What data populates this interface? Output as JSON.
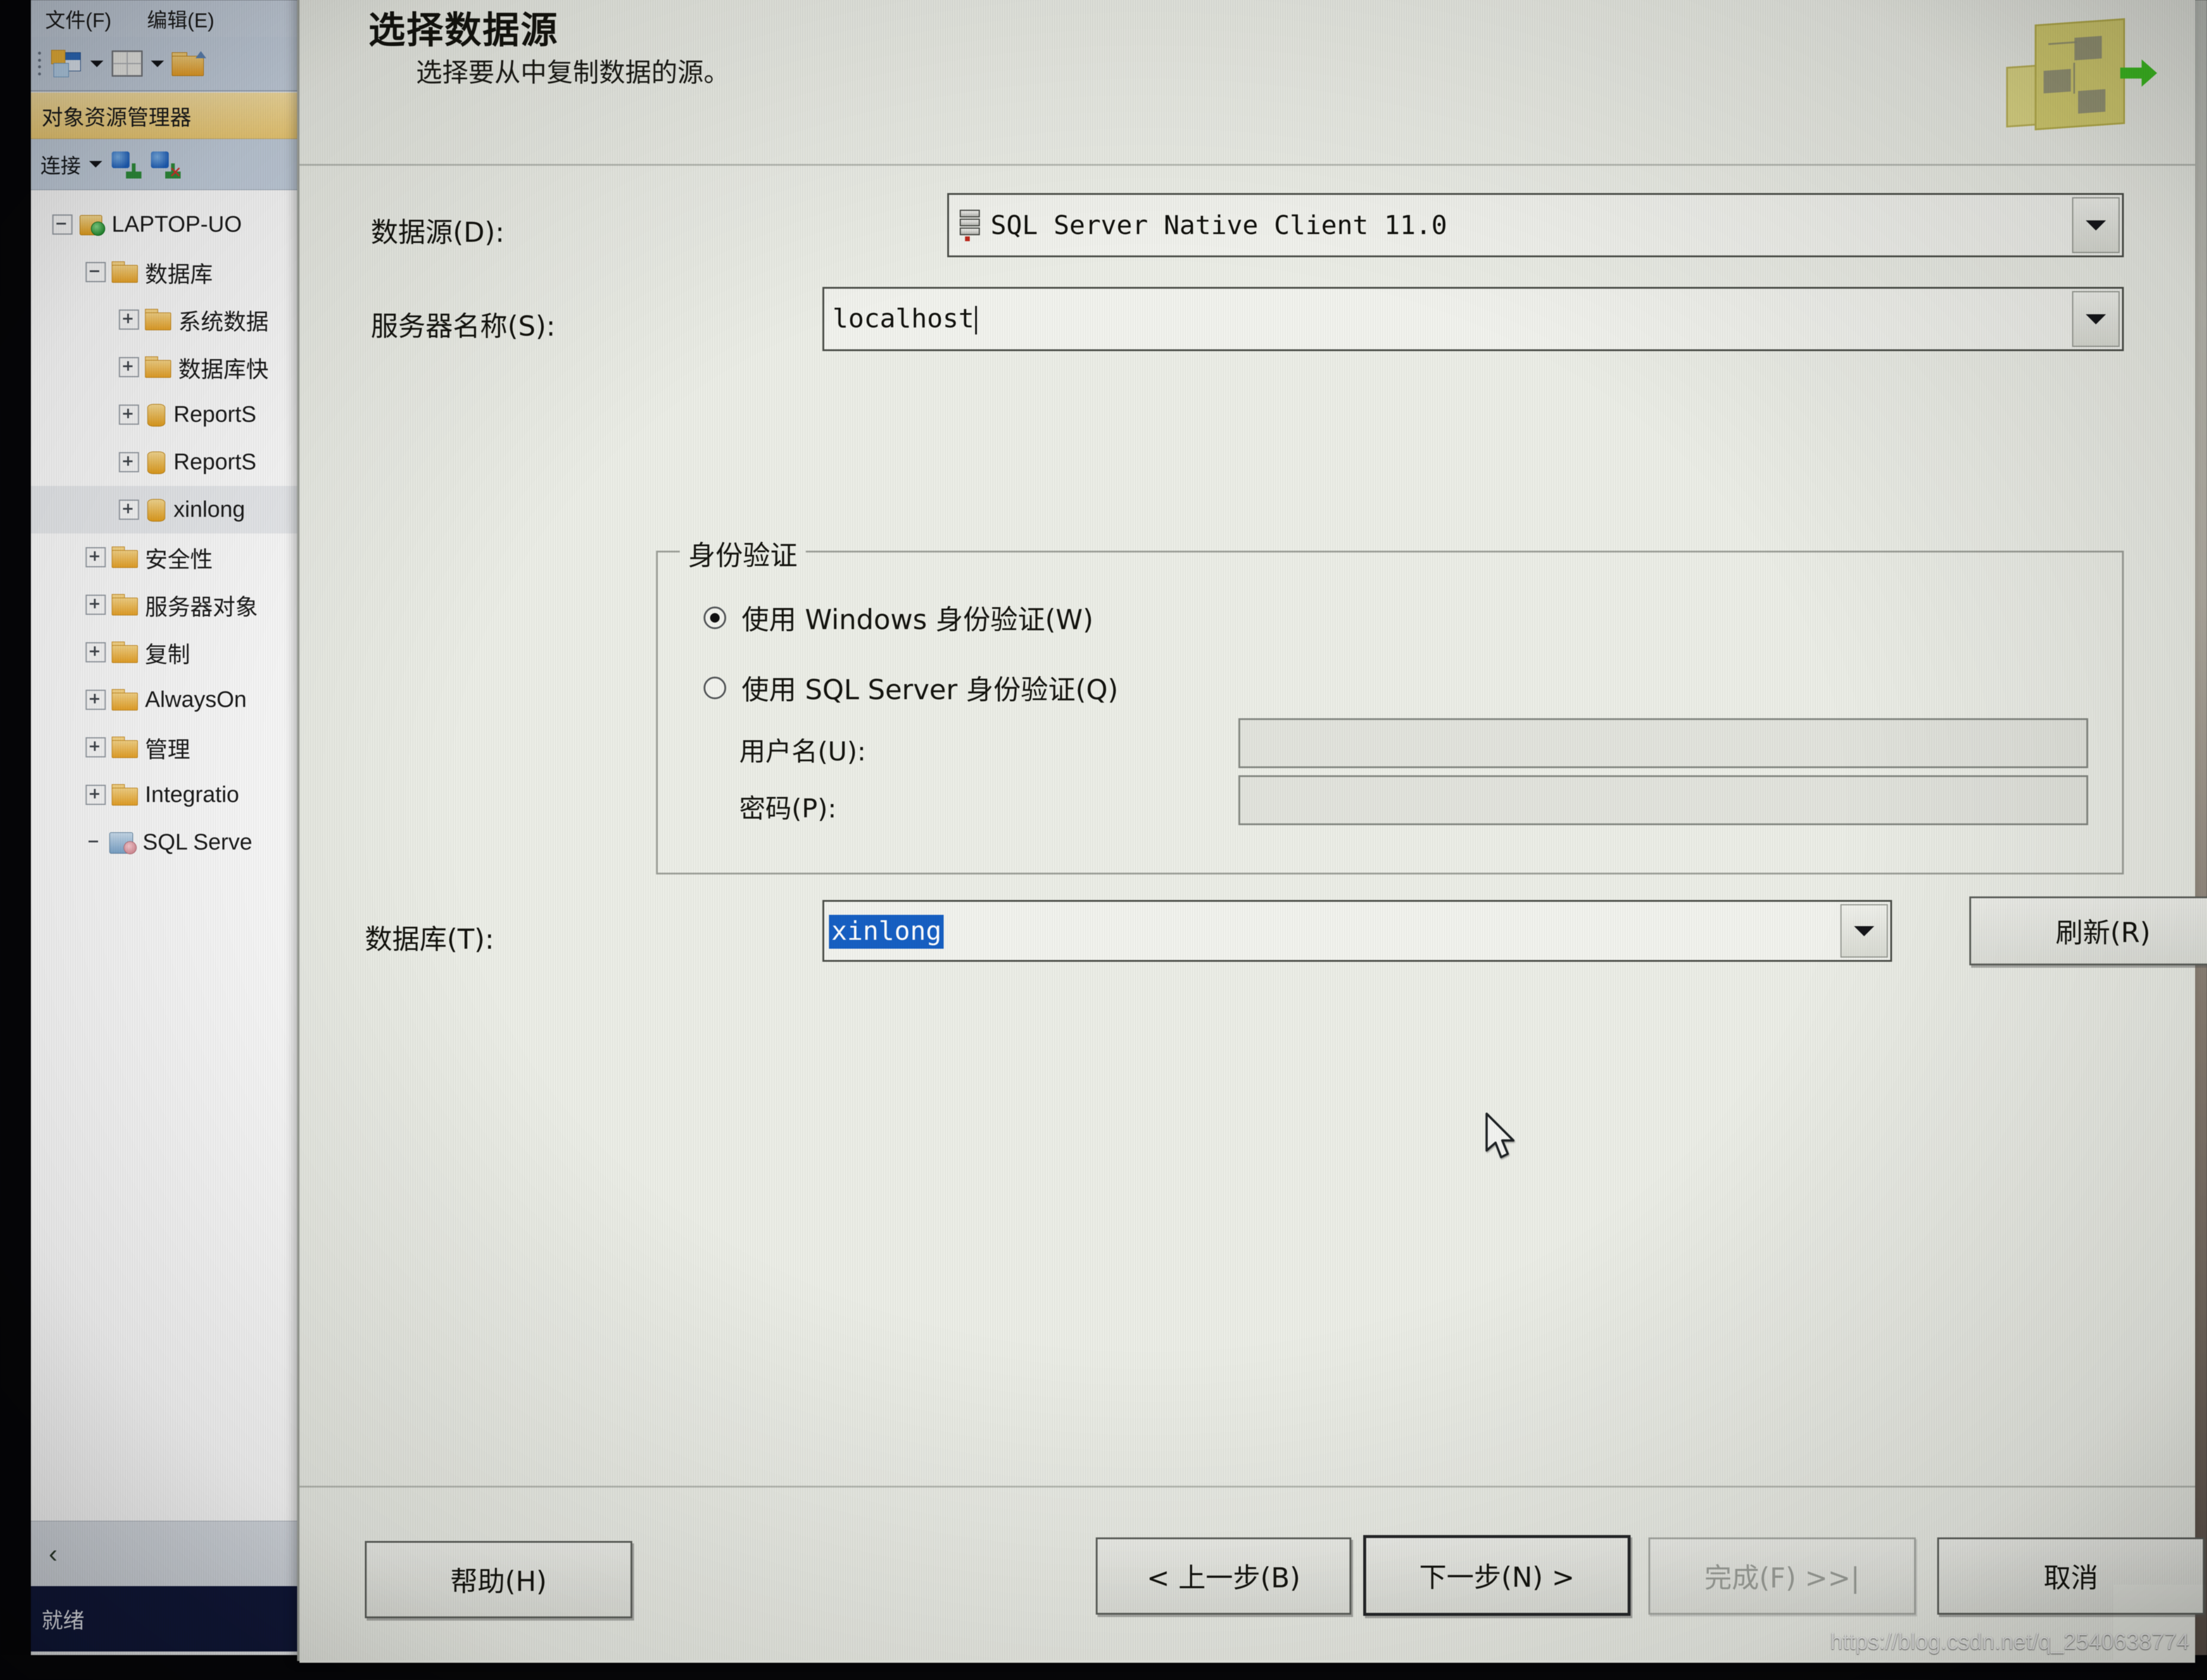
{
  "app": {
    "menu": [
      {
        "label": "文件(F)"
      },
      {
        "label": "编辑(E)"
      }
    ],
    "toolbar_icons": [
      "new-query-icon",
      "dropdown-caret-icon",
      "new-table-icon",
      "dropdown-caret-icon",
      "open-file-icon"
    ],
    "object_explorer": {
      "title": "对象资源管理器",
      "connect_label": "连接",
      "tree": [
        {
          "level": 0,
          "expander": "minus",
          "icon": "server-icon",
          "label": "LAPTOP-UO"
        },
        {
          "level": 1,
          "expander": "minus",
          "icon": "folder-icon",
          "label": "数据库"
        },
        {
          "level": 2,
          "expander": "plus",
          "icon": "folder-icon",
          "label": "系统数据"
        },
        {
          "level": 2,
          "expander": "plus",
          "icon": "folder-icon",
          "label": "数据库快"
        },
        {
          "level": 2,
          "expander": "plus",
          "icon": "database-icon",
          "label": "ReportS"
        },
        {
          "level": 2,
          "expander": "plus",
          "icon": "database-icon",
          "label": "ReportS"
        },
        {
          "level": 2,
          "expander": "plus",
          "icon": "database-icon",
          "label": "xinlong",
          "selected": true
        },
        {
          "level": 1,
          "expander": "plus",
          "icon": "folder-icon",
          "label": "安全性"
        },
        {
          "level": 1,
          "expander": "plus",
          "icon": "folder-icon",
          "label": "服务器对象"
        },
        {
          "level": 1,
          "expander": "plus",
          "icon": "folder-icon",
          "label": "复制"
        },
        {
          "level": 1,
          "expander": "plus",
          "icon": "folder-icon",
          "label": "AlwaysOn"
        },
        {
          "level": 1,
          "expander": "plus",
          "icon": "folder-icon",
          "label": "管理"
        },
        {
          "level": 1,
          "expander": "plus",
          "icon": "folder-icon",
          "label": "Integratio"
        },
        {
          "level": 1,
          "expander": "none",
          "icon": "sql-agent-icon",
          "label": "SQL Serve"
        }
      ]
    },
    "status_bar": {
      "text": "就绪"
    },
    "collapse_chevron": "‹"
  },
  "dialog": {
    "title": "选择数据源",
    "subtitle": "选择要从中复制数据的源。",
    "wizard_icon": "data-flow-wizard-icon",
    "fields": {
      "data_source": {
        "label": "数据源(D):",
        "value": "SQL Server Native Client 11.0",
        "icon": "data-provider-icon"
      },
      "server_name": {
        "label": "服务器名称(S):",
        "value": "localhost"
      },
      "auth_group": {
        "label": "身份验证",
        "options": [
          {
            "label": "使用 Windows 身份验证(W)",
            "selected": true
          },
          {
            "label": "使用 SQL Server 身份验证(Q)",
            "selected": false
          }
        ],
        "username": {
          "label": "用户名(U):",
          "value": ""
        },
        "password": {
          "label": "密码(P):",
          "value": ""
        }
      },
      "database": {
        "label": "数据库(T):",
        "value": "xinlong",
        "text_selected": true,
        "refresh_button": "刷新(R)"
      }
    },
    "buttons": {
      "help": "帮助(H)",
      "back": "< 上一步(B)",
      "next": "下一步(N) >",
      "finish": "完成(F) >>|",
      "cancel": "取消"
    }
  },
  "overlay": {
    "watermark": "https://blog.csdn.net/q_2540638774",
    "cursor": "mouse-pointer-icon"
  }
}
